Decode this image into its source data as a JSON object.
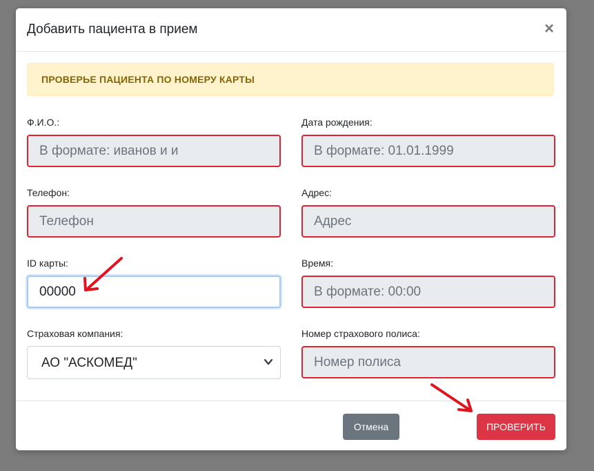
{
  "modal": {
    "title": "Добавить пациента в прием",
    "close_symbol": "×"
  },
  "alert": {
    "text": "ПРОВЕРЬЕ ПАЦИЕНТА ПО НОМЕРУ КАРТЫ"
  },
  "form": {
    "fio": {
      "label": "Ф.И.О.:",
      "placeholder": "В формате: иванов и и"
    },
    "birth_date": {
      "label": "Дата рождения:",
      "placeholder": "В формате: 01.01.1999"
    },
    "phone": {
      "label": "Телефон:",
      "placeholder": "Телефон"
    },
    "address": {
      "label": "Адрес:",
      "placeholder": "Адрес"
    },
    "card_id": {
      "label": "ID карты:",
      "value": "00000"
    },
    "time": {
      "label": "Время:",
      "placeholder": "В формате: 00:00"
    },
    "insurance_company": {
      "label": "Страховая компания:",
      "selected": "АО \"АСКОМЕД\""
    },
    "policy_number": {
      "label": "Номер страхового полиса:",
      "placeholder": "Номер полиса"
    }
  },
  "footer": {
    "cancel_label": "Отмена",
    "check_label": "ПРОВЕРИТЬ"
  },
  "colors": {
    "overlay": "#7c7c7c",
    "alert_bg": "#fff3cd",
    "alert_text": "#856404",
    "invalid_border": "#dc2233",
    "cancel_button": "#6c757d",
    "check_button": "#dc3545",
    "annotation_arrow": "#e0141e"
  },
  "icons": {
    "close": "close-icon",
    "select_chevron": "chevron-down-icon",
    "annotation": "arrow-annotation-icon"
  }
}
